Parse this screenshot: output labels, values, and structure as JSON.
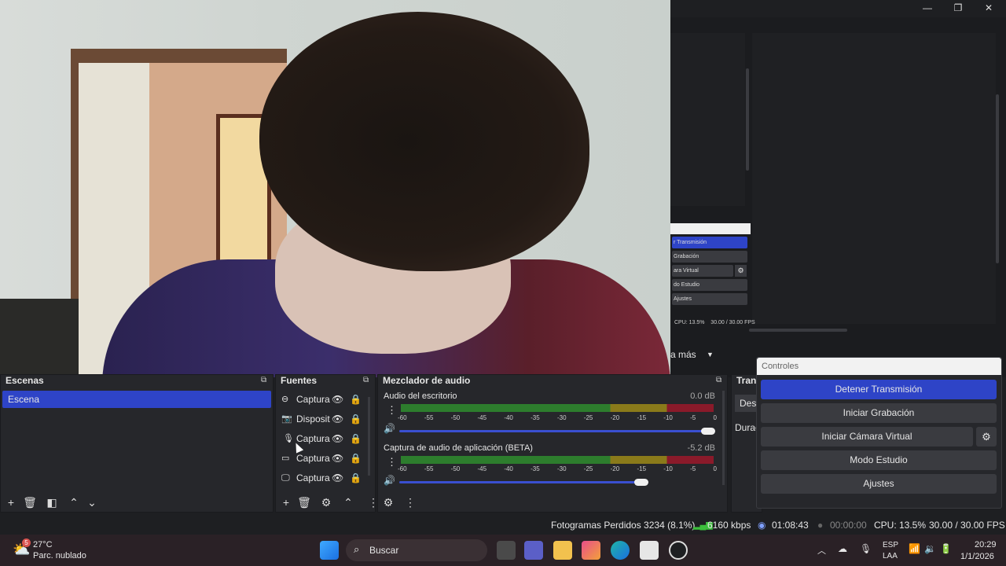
{
  "window": {
    "minimize": "—",
    "restore": "❐",
    "close": "✕"
  },
  "preview_mini": {
    "buttons": [
      "r Transmisión",
      "Grabación",
      "ara Virtual",
      "do Estudio",
      "Ajustes"
    ],
    "status": "CPU: 13.5%    30.00 / 30.00 FPS"
  },
  "more_label": "a más",
  "scenes": {
    "title": "Escenas",
    "items": [
      "Escena"
    ]
  },
  "sources": {
    "title": "Fuentes",
    "items": [
      {
        "label": "Captura",
        "icon": "gamepad-icon"
      },
      {
        "label": "Disposit",
        "icon": "camera-icon"
      },
      {
        "label": "Captura",
        "icon": "microphone-icon"
      },
      {
        "label": "Captura",
        "icon": "window-icon"
      },
      {
        "label": "Captura",
        "icon": "display-icon"
      }
    ]
  },
  "mixer": {
    "title": "Mezclador de audio",
    "ticks": [
      "-60",
      "-55",
      "-50",
      "-45",
      "-40",
      "-35",
      "-30",
      "-25",
      "-20",
      "-15",
      "-10",
      "-5",
      "0"
    ],
    "channels": [
      {
        "name": "Audio del escritorio",
        "db": "0.0 dB",
        "volume": 1.0
      },
      {
        "name": "Captura de audio de aplicación (BETA)",
        "db": "-5.2 dB",
        "volume": 0.76
      }
    ]
  },
  "transitions": {
    "title": "Trans",
    "select": "Desv",
    "duration": "Durac"
  },
  "controls": {
    "title": "Controles",
    "stop_stream": "Detener Transmisión",
    "start_record": "Iniciar Grabación",
    "start_vcam": "Iniciar Cámara Virtual",
    "studio_mode": "Modo Estudio",
    "settings": "Ajustes"
  },
  "status": {
    "dropped": "Fotogramas Perdidos 3234 (8.1%)",
    "bitrate": "6160 kbps",
    "stream_time": "01:08:43",
    "rec_time": "00:00:00",
    "cpu": "CPU: 13.5%",
    "fps": "30.00 / 30.00 FPS"
  },
  "taskbar": {
    "weather_temp": "27°C",
    "weather_desc": "Parc. nublado",
    "weather_badge": "5",
    "search": "Buscar",
    "lang1": "ESP",
    "lang2": "LAA",
    "time": "20:29",
    "date": "1/1/2026"
  },
  "colors": {
    "accent": "#2e44c7",
    "dark": "#1e1f22",
    "panel": "#26272b"
  }
}
